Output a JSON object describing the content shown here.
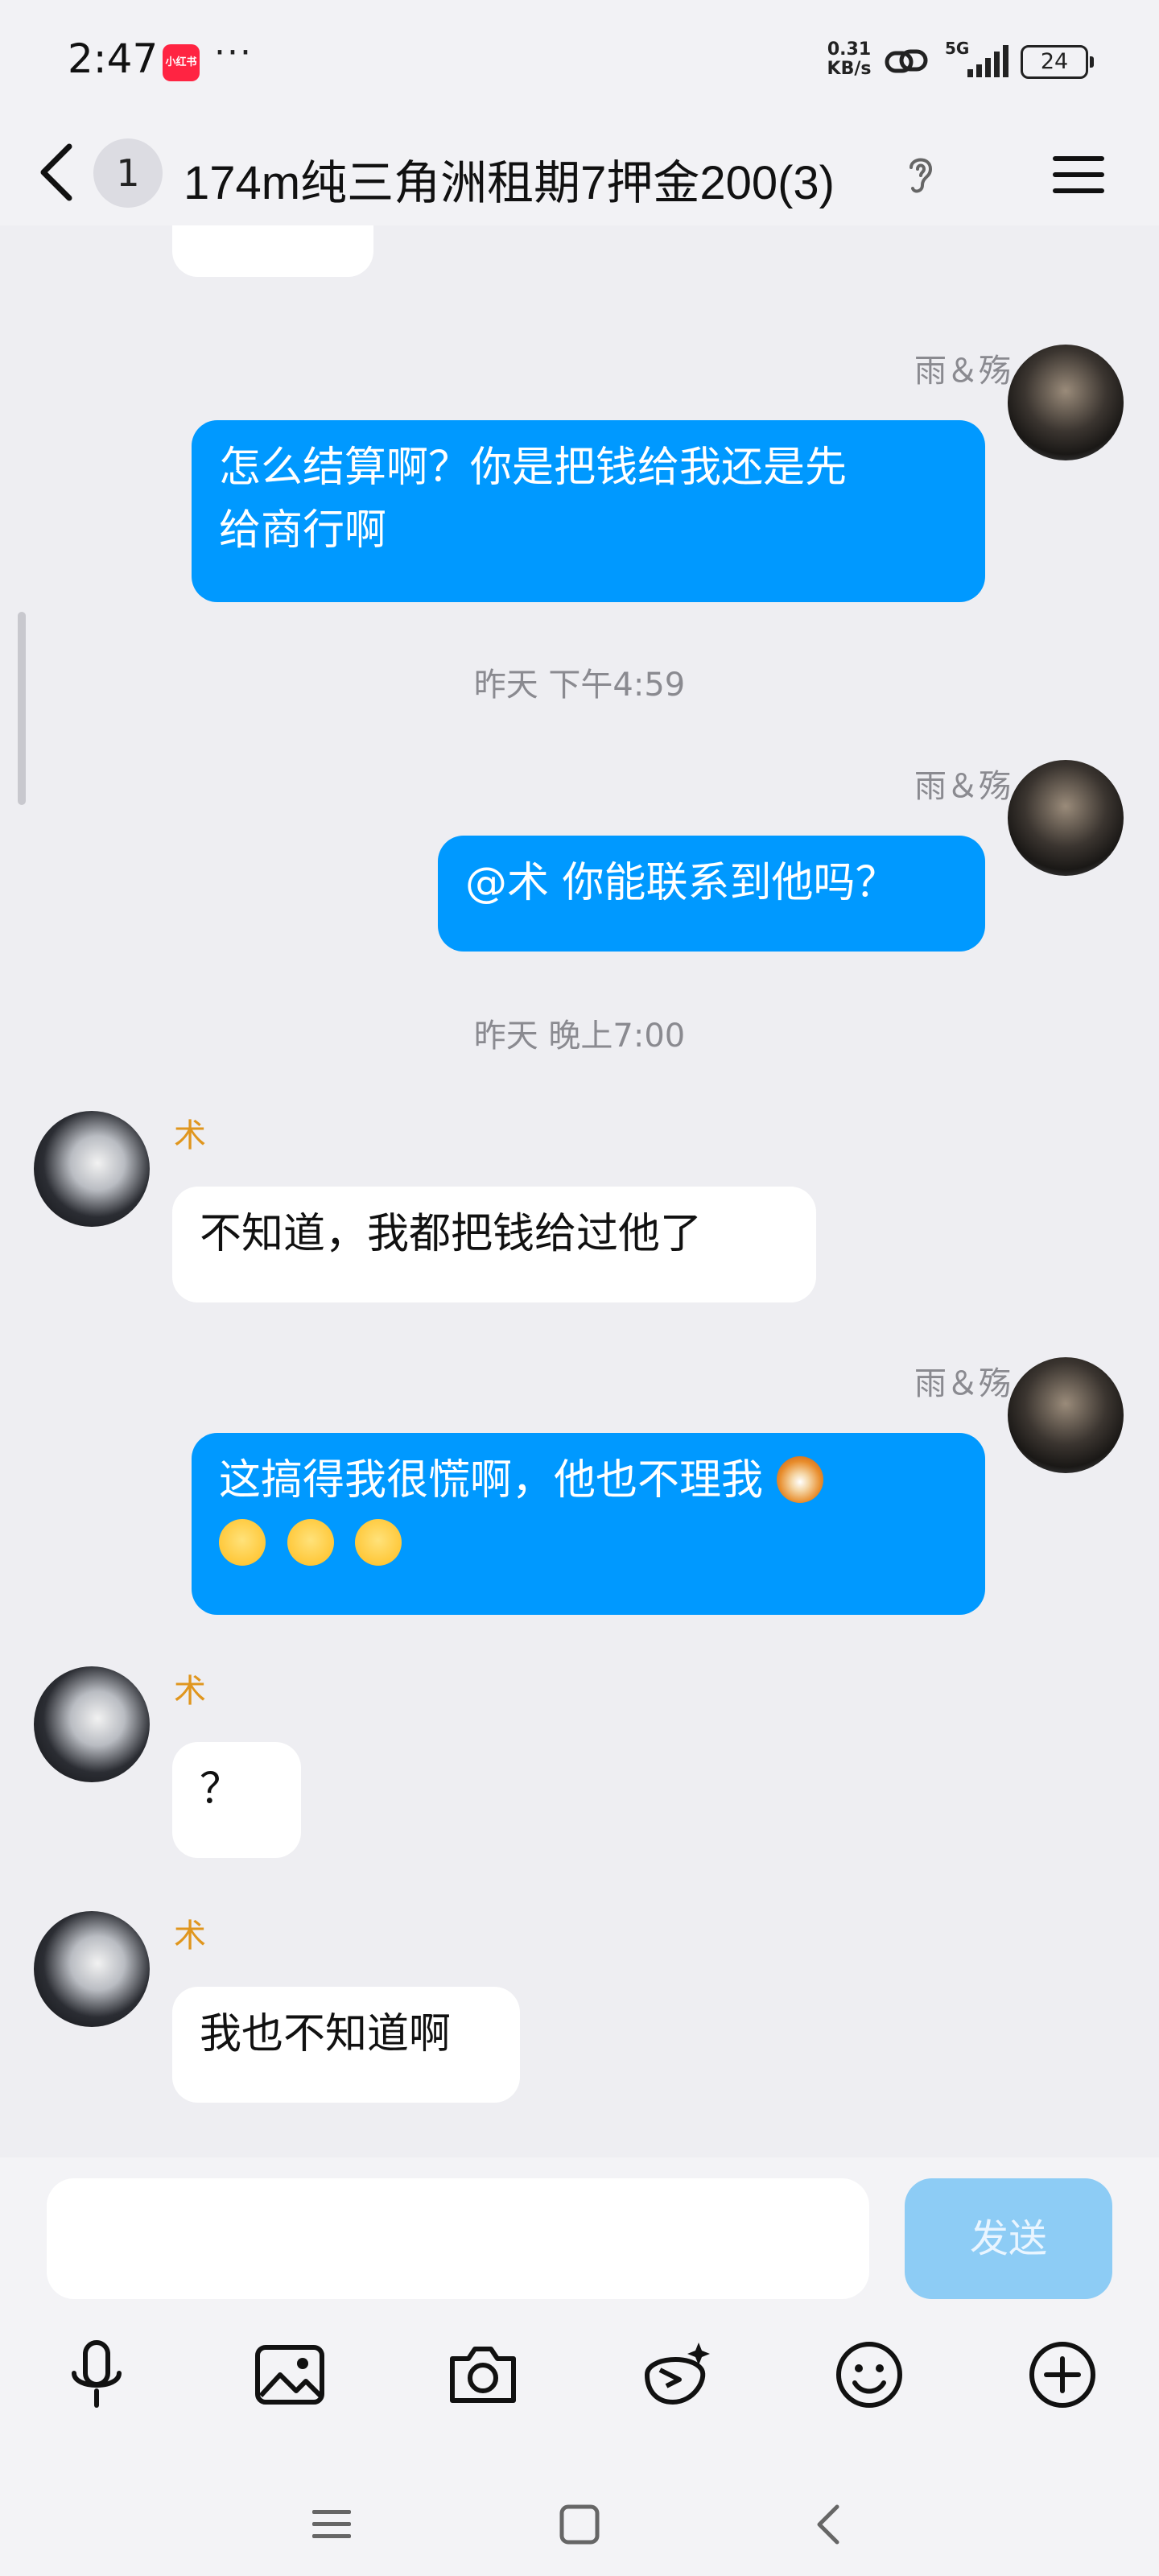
{
  "status_bar": {
    "time": "2:47",
    "app_badge": "小红书",
    "dots": "···",
    "net_speed_value": "0.31",
    "net_speed_unit": "KB/s",
    "signal_label": "5G",
    "battery": "24"
  },
  "header": {
    "unread_count": "1",
    "title": "174m纯三角洲租期7押金200(3)"
  },
  "messages": [
    {
      "sender": "雨＆殇",
      "text": "怎么结算啊？你是把钱给我还是先给商行啊",
      "line1": "怎么结算啊？你是把钱给我还是先",
      "line2": "给商行啊"
    },
    {
      "timestamp": "昨天 下午4:59"
    },
    {
      "sender": "雨＆殇",
      "text": "@术 你能联系到他吗？"
    },
    {
      "timestamp": "昨天 晚上7:00"
    },
    {
      "sender": "术",
      "text": "不知道，我都把钱给过他了"
    },
    {
      "sender": "雨＆殇",
      "text": "这搞得我很慌啊，他也不理我"
    },
    {
      "sender": "术",
      "text": "？"
    },
    {
      "sender": "术",
      "text": "我也不知道啊"
    }
  ],
  "input": {
    "placeholder": "",
    "send_label": "发送"
  },
  "colors": {
    "outgoing_bubble": "#0099ff",
    "incoming_bubble": "#ffffff",
    "incoming_name": "#e0961e",
    "send_disabled": "#8dccf5"
  }
}
